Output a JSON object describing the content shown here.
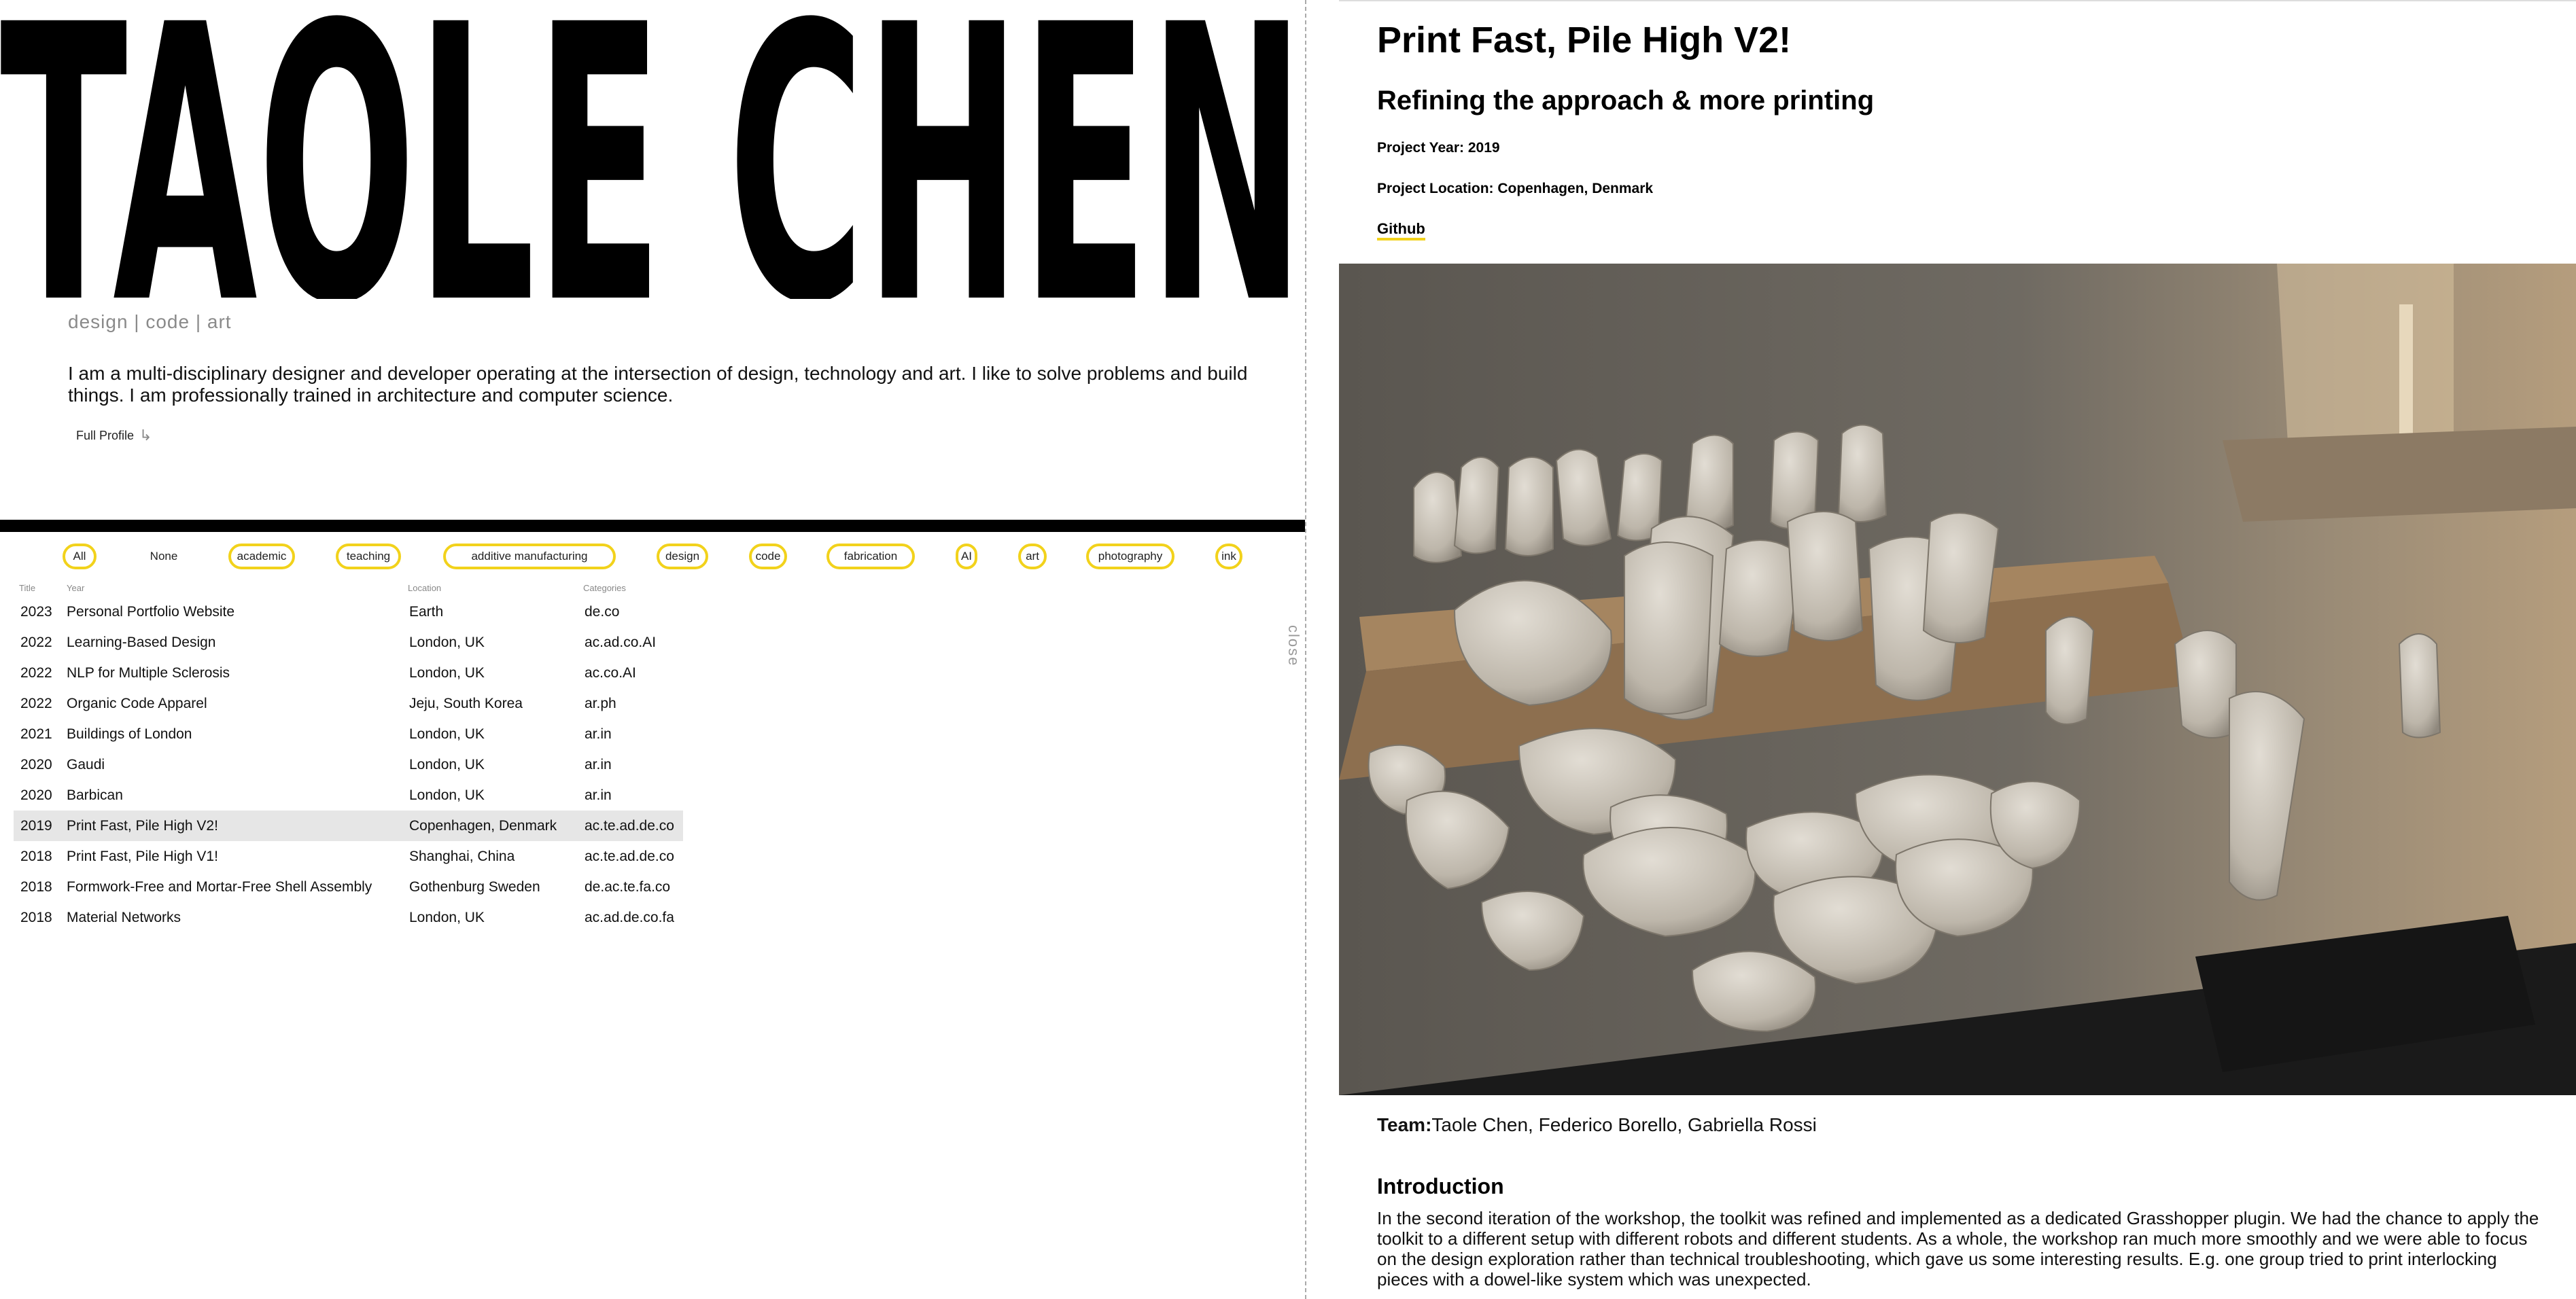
{
  "profile": {
    "name": "TAOLE CHEN",
    "tagline": "design | code | art",
    "bio": "I am a multi-disciplinary designer and developer operating at the intersection of design, technology and art. I like to solve problems and build things. I am professionally trained in architecture and computer science.",
    "full_profile_label": "Full Profile"
  },
  "filters": [
    "All",
    "None",
    "academic",
    "teaching",
    "additive manufacturing",
    "design",
    "code",
    "fabrication",
    "AI",
    "art",
    "photography",
    "ink"
  ],
  "table": {
    "headers": [
      "Title",
      "Year",
      "Location",
      "Categories"
    ],
    "rows": [
      {
        "year": "2023",
        "title": "Personal Portfolio Website",
        "location": "Earth",
        "categories": "de.co"
      },
      {
        "year": "2022",
        "title": "Learning-Based Design",
        "location": "London, UK",
        "categories": "ac.ad.co.AI"
      },
      {
        "year": "2022",
        "title": "NLP for Multiple Sclerosis",
        "location": "London, UK",
        "categories": "ac.co.AI"
      },
      {
        "year": "2022",
        "title": "Organic Code Apparel",
        "location": "Jeju, South Korea",
        "categories": "ar.ph"
      },
      {
        "year": "2021",
        "title": "Buildings of London",
        "location": "London, UK",
        "categories": "ar.in"
      },
      {
        "year": "2020",
        "title": "Gaudi",
        "location": "London, UK",
        "categories": "ar.in"
      },
      {
        "year": "2020",
        "title": "Barbican",
        "location": "London, UK",
        "categories": "ar.in"
      },
      {
        "year": "2019",
        "title": "Print Fast, Pile High V2!",
        "location": "Copenhagen, Denmark",
        "categories": "ac.te.ad.de.co",
        "selected": true
      },
      {
        "year": "2018",
        "title": "Print Fast, Pile High V1!",
        "location": "Shanghai, China",
        "categories": "ac.te.ad.de.co"
      },
      {
        "year": "2018",
        "title": "Formwork-Free and Mortar-Free Shell Assembly",
        "location": "Gothenburg Sweden",
        "categories": "de.ac.te.fa.co"
      },
      {
        "year": "2018",
        "title": "Material Networks",
        "location": "London, UK",
        "categories": "ac.ad.de.co.fa"
      }
    ]
  },
  "close_label": "close",
  "project": {
    "title": "Print Fast, Pile High V2!",
    "subtitle": "Refining the approach & more printing",
    "year_line": "Project Year: 2019",
    "location_line": "Project Location: Copenhagen, Denmark",
    "github_label": "Github",
    "team_label": "Team:",
    "team": "Taole Chen, Federico Borello, Gabriella Rossi",
    "intro_heading": "Introduction",
    "intro_text": "In the second iteration of the workshop, the toolkit was refined and implemented as a dedicated Grasshopper plugin. We had the chance to apply the toolkit to a different setup with different robots and different students. As a whole, the workshop ran much more smoothly and we were able to focus on the design exploration rather than technical troubleshooting, which gave us some interesting results. E.g. one group tried to print interlocking pieces with a dowel-like system which was unexpected."
  },
  "colors": {
    "accent": "#f2d21b",
    "selected_row": "#e6e6e6",
    "ink": "#000000"
  }
}
